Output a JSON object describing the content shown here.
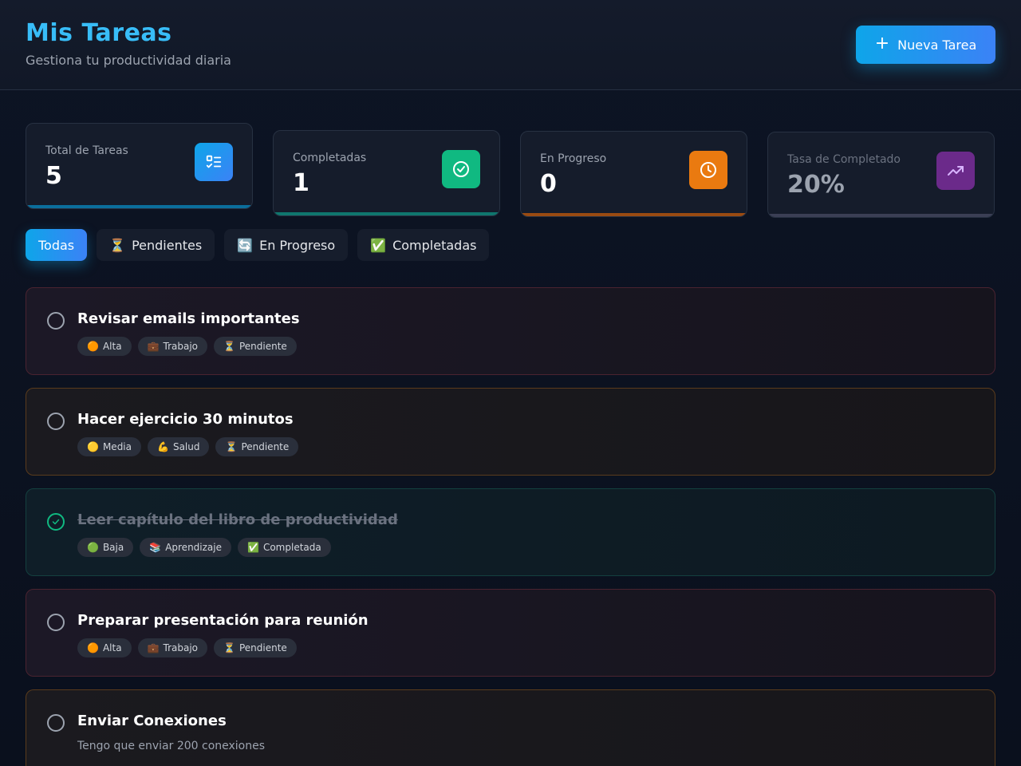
{
  "header": {
    "title": "Mis Tareas",
    "subtitle": "Gestiona tu productividad diaria",
    "new_task_label": "Nueva Tarea"
  },
  "stats": [
    {
      "label": "Total de Tareas",
      "value": "5",
      "color": "#0ea5e9",
      "icon": "checklist-icon"
    },
    {
      "label": "Completadas",
      "value": "1",
      "color": "#10b981",
      "icon": "check-circle-icon"
    },
    {
      "label": "En Progreso",
      "value": "0",
      "color": "#f97316",
      "icon": "clock-icon"
    },
    {
      "label": "Tasa de Completado",
      "value": "20%",
      "color": "#7e22ce",
      "icon": "trending-up-icon"
    }
  ],
  "filters": [
    {
      "label": "Todas",
      "emoji": ""
    },
    {
      "label": "Pendientes",
      "emoji": "⏳"
    },
    {
      "label": "En Progreso",
      "emoji": "🔄"
    },
    {
      "label": "Completadas",
      "emoji": "✅"
    }
  ],
  "tasks": [
    {
      "title": "Revisar emails importantes",
      "tags": [
        {
          "emoji": "🟠",
          "label": "Alta"
        },
        {
          "emoji": "💼",
          "label": "Trabajo"
        },
        {
          "emoji": "⏳",
          "label": "Pendiente"
        }
      ]
    },
    {
      "title": "Hacer ejercicio 30 minutos",
      "tags": [
        {
          "emoji": "🟡",
          "label": "Media"
        },
        {
          "emoji": "💪",
          "label": "Salud"
        },
        {
          "emoji": "⏳",
          "label": "Pendiente"
        }
      ]
    },
    {
      "title": "Leer capítulo del libro de productividad",
      "tags": [
        {
          "emoji": "🟢",
          "label": "Baja"
        },
        {
          "emoji": "📚",
          "label": "Aprendizaje"
        },
        {
          "emoji": "✅",
          "label": "Completada"
        }
      ]
    },
    {
      "title": "Preparar presentación para reunión",
      "tags": [
        {
          "emoji": "🟠",
          "label": "Alta"
        },
        {
          "emoji": "💼",
          "label": "Trabajo"
        },
        {
          "emoji": "⏳",
          "label": "Pendiente"
        }
      ]
    },
    {
      "title": "Enviar Conexiones",
      "description": "Tengo que enviar 200 conexiones"
    }
  ]
}
